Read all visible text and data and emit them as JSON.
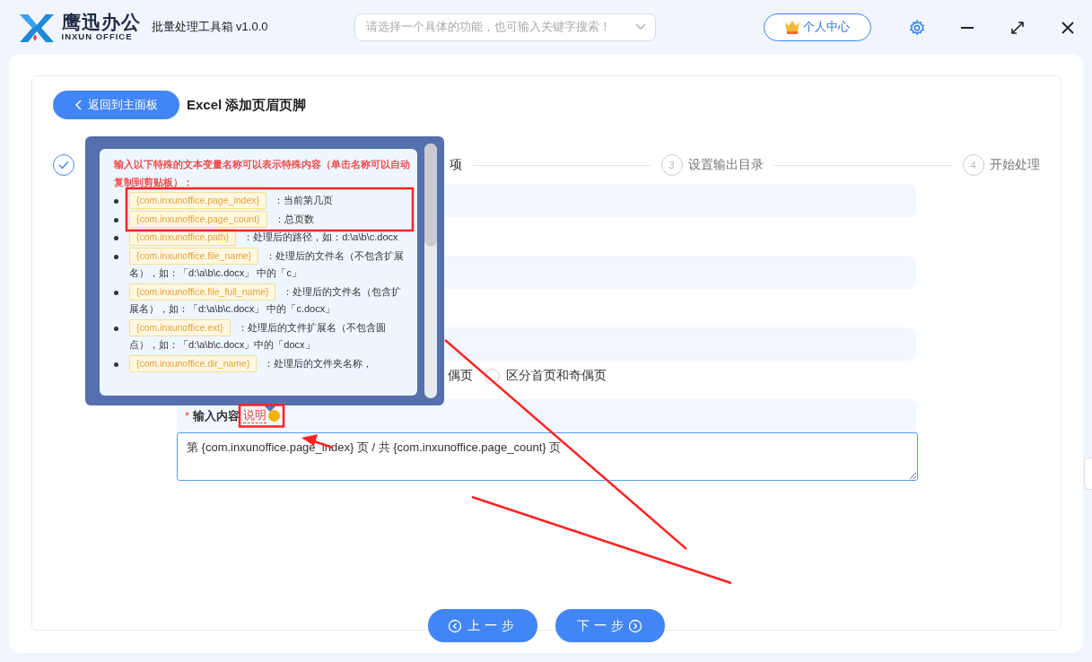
{
  "app": {
    "brand": "鹰迅办公",
    "brand_sub": "INXUN OFFICE",
    "title": "批量处理工具箱 v1.0.0"
  },
  "search": {
    "placeholder": "请选择一个具体的功能，也可输入关键字搜索！"
  },
  "user_button": "个人中心",
  "back_button": "返回到主面板",
  "page_title": "Excel 添加页眉页脚",
  "steps": [
    {
      "completed": true,
      "active": false
    },
    {
      "label": "项",
      "completed": false,
      "active": true
    },
    {
      "number": "3",
      "label": "设置输出目录",
      "completed": false,
      "active": false
    },
    {
      "number": "4",
      "label": "开始处理",
      "completed": false,
      "active": false
    }
  ],
  "radio_partial_label": "偶页",
  "radio_options": [
    {
      "label": "区分首页和奇偶页",
      "selected": false
    }
  ],
  "content_field": {
    "required_mark": "*",
    "label": "输入内容",
    "required": true,
    "help_link": "说明",
    "value": "第 {com.inxunoffice.page_index} 页 / 共 {com.inxunoffice.page_count} 页"
  },
  "help_popover": {
    "intro": "输入以下特殊的文本变量名称可以表示特殊内容（单击名称可以自动复制到剪贴板）：",
    "items": [
      {
        "variable": "{com.inxunoffice.page_index}",
        "description": "：当前第几页"
      },
      {
        "variable": "{com.inxunoffice.page_count}",
        "description": "：总页数"
      },
      {
        "variable": "{com.inxunoffice.path}",
        "description": "：处理后的路径，如：d:\\a\\b\\c.docx"
      },
      {
        "variable": "{com.inxunoffice.file_name}",
        "description": "：处理后的文件名（不包含扩展名），如：「d:\\a\\b\\c.docx」 中的「c」"
      },
      {
        "variable": "{com.inxunoffice.file_full_name}",
        "description": "：处理后的文件名（包含扩展名），如：「d:\\a\\b\\c.docx」 中的「c.docx」"
      },
      {
        "variable": "{com.inxunoffice.ext}",
        "description": "：处理后的文件扩展名（不包含圆点），如：「d:\\a\\b\\c.docx」中的「docx」"
      },
      {
        "variable": "{com.inxunoffice.dir_name}",
        "description": "：处理后的文件夹名称，"
      }
    ]
  },
  "prev_button": "上一步",
  "next_button": "下一步"
}
